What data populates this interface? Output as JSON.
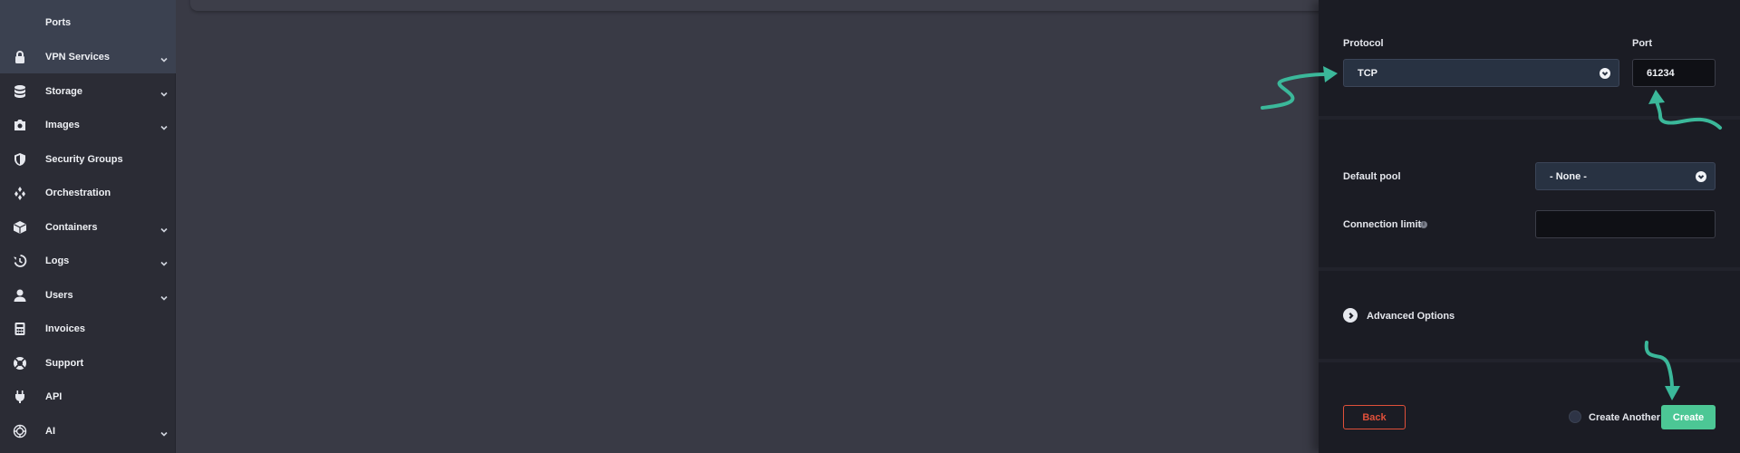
{
  "sidebar": {
    "items": [
      {
        "label": "Ports",
        "icon": "none",
        "chevron": false
      },
      {
        "label": "VPN Services",
        "icon": "lock-icon",
        "chevron": true
      },
      {
        "label": "Storage",
        "icon": "database-icon",
        "chevron": true
      },
      {
        "label": "Images",
        "icon": "camera-icon",
        "chevron": true
      },
      {
        "label": "Security Groups",
        "icon": "shield-icon",
        "chevron": false
      },
      {
        "label": "Orchestration",
        "icon": "orchestration-icon",
        "chevron": false
      },
      {
        "label": "Containers",
        "icon": "box-icon",
        "chevron": true
      },
      {
        "label": "Logs",
        "icon": "history-icon",
        "chevron": true
      },
      {
        "label": "Users",
        "icon": "user-icon",
        "chevron": true
      },
      {
        "label": "Invoices",
        "icon": "calculator-icon",
        "chevron": false
      },
      {
        "label": "Support",
        "icon": "lifebuoy-icon",
        "chevron": false
      },
      {
        "label": "API",
        "icon": "plug-icon",
        "chevron": false
      },
      {
        "label": "AI",
        "icon": "ai-icon",
        "chevron": true
      }
    ]
  },
  "form": {
    "protocol_label": "Protocol",
    "protocol_value": "TCP",
    "port_label": "Port",
    "port_value": "61234",
    "default_pool_label": "Default pool",
    "default_pool_value": "- None -",
    "connection_limit_label": "Connection limit",
    "connection_limit_value": "",
    "advanced_options_label": "Advanced Options",
    "back_label": "Back",
    "create_another_label": "Create Another",
    "create_label": "Create"
  },
  "colors": {
    "accent": "#4cc795",
    "danger": "#e0503a",
    "annotation": "#3bb89a"
  }
}
